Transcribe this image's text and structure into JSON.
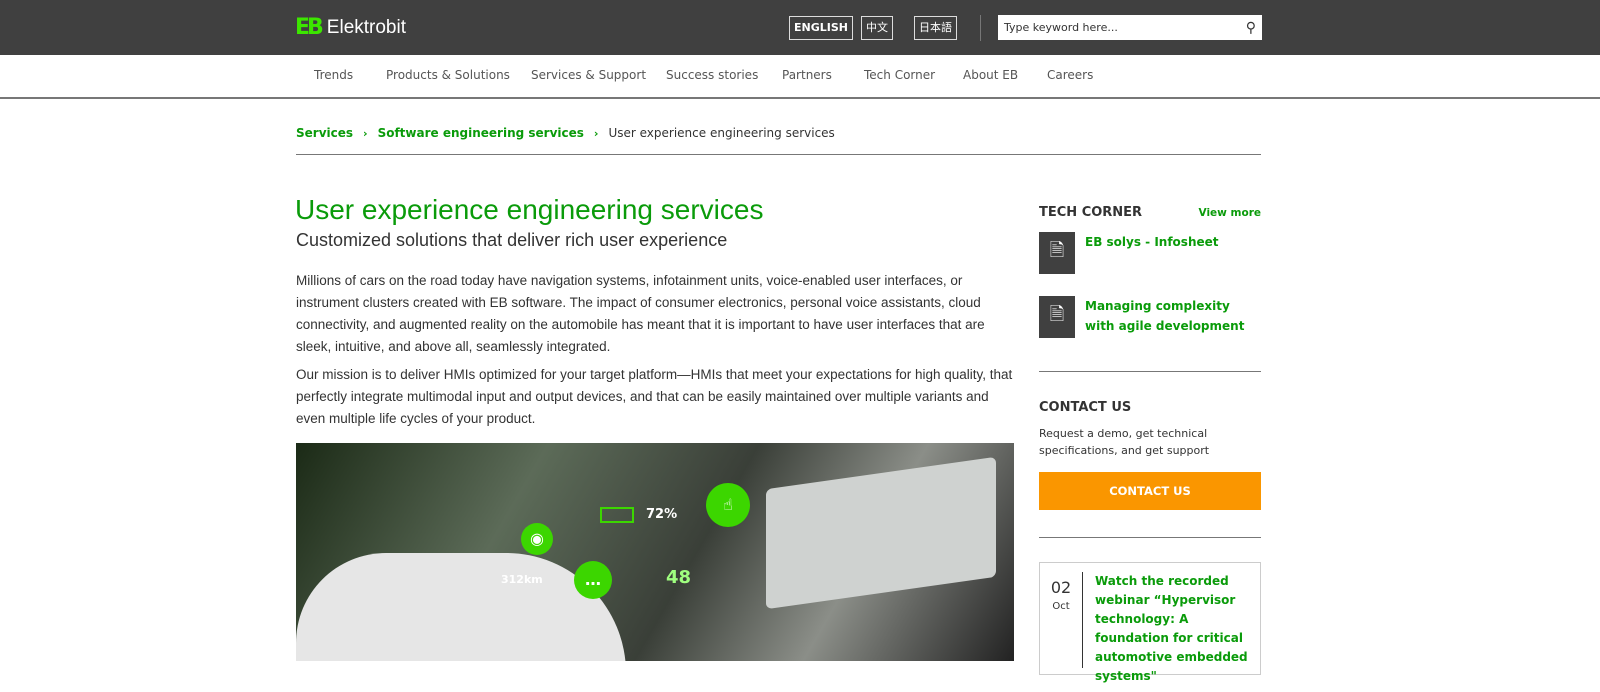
{
  "brand": {
    "mark": "EB",
    "name": "Elektrobit",
    "accent": "#0a9b0a",
    "logo_color": "#3ce600"
  },
  "header": {
    "languages": [
      "ENGLISH",
      "中文",
      "日本語"
    ],
    "search_placeholder": "Type keyword here...",
    "search_icon": "search-icon"
  },
  "nav": [
    "Trends",
    "Products & Solutions",
    "Services & Support",
    "Success stories",
    "Partners",
    "Tech Corner",
    "About EB",
    "Careers"
  ],
  "breadcrumb": [
    "Services",
    "Software engineering services",
    "User experience engineering services"
  ],
  "main": {
    "title": "User experience engineering services",
    "subtitle": "Customized solutions that deliver rich user experience",
    "paragraphs": [
      "Millions of cars on the road today have navigation systems, infotainment units, voice-enabled user interfaces, or instrument clusters created with EB software. The impact of consumer electronics, personal voice assistants, cloud connectivity, and augmented reality on the automobile has meant that it is important to have user interfaces that are sleek, intuitive, and above all, seamlessly integrated.",
      "Our mission is to deliver HMIs optimized for your target platform—HMIs that meet your expectations for high quality, that perfectly integrate multimodal input and output devices, and that can be easily maintained over multiple variants and even multiple life cycles of your product."
    ],
    "hero": {
      "battery": "72%",
      "speed": "48",
      "range": "312km"
    }
  },
  "sidebar": {
    "tech_corner": {
      "title": "TECH CORNER",
      "view_more": "View more",
      "items": [
        "EB solys - Infosheet",
        "Managing complexity with agile development"
      ]
    },
    "contact": {
      "title": "CONTACT US",
      "text": "Request a demo, get technical specifications, and get support",
      "button": "CONTACT US",
      "button_color": "#fa9600"
    },
    "event": {
      "day": "02",
      "month": "Oct",
      "title": "Watch the recorded webinar “Hypervisor technology: A foundation for critical automotive embedded systems\""
    }
  }
}
